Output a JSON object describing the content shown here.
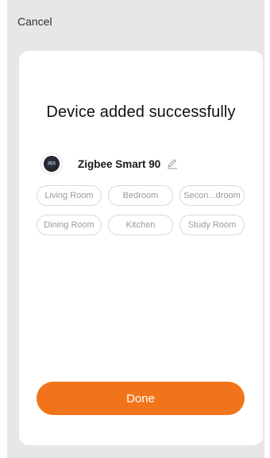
{
  "header": {
    "cancel_label": "Cancel"
  },
  "card": {
    "title": "Device added successfully",
    "device": {
      "name": "Zigbee Smart 90",
      "display_value": "20.5",
      "icon": "thermostat-icon"
    },
    "rooms": [
      "Living Room",
      "Bedroom",
      "Secon...droom",
      "Dining Room",
      "Kitchen",
      "Study Room"
    ],
    "done_label": "Done"
  },
  "colors": {
    "accent": "#f2741a",
    "background": "#e7e7e7",
    "card": "#ffffff",
    "chip_border": "#d9d9d9",
    "chip_text": "#9a9a9a"
  }
}
